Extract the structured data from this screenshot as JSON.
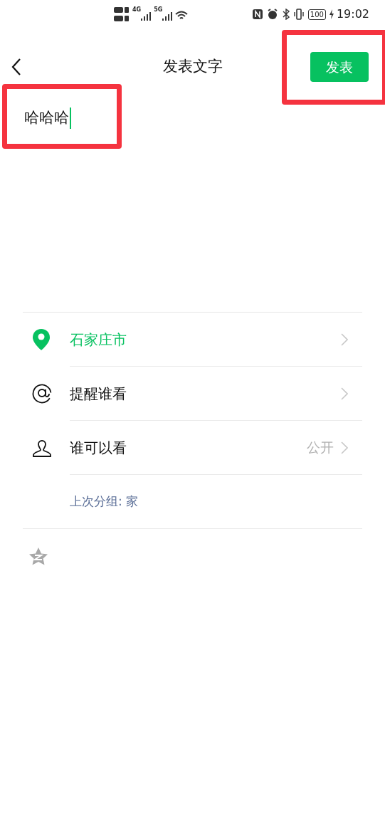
{
  "status_bar": {
    "network_labels": [
      "4G",
      "5G"
    ],
    "battery": "100",
    "time": "19:02"
  },
  "header": {
    "title": "发表文字",
    "publish_button": "发表"
  },
  "post_input": {
    "value": "哈哈哈",
    "focused": true
  },
  "options": [
    {
      "kind": "location",
      "label": "石家庄市"
    },
    {
      "kind": "mention",
      "label": "提醒谁看"
    },
    {
      "kind": "visibility",
      "label": "谁可以看",
      "value": "公开"
    }
  ],
  "last_group": "上次分组: 家",
  "annotations": [
    {
      "kind": "highlight-box"
    },
    {
      "kind": "highlight-box"
    }
  ]
}
